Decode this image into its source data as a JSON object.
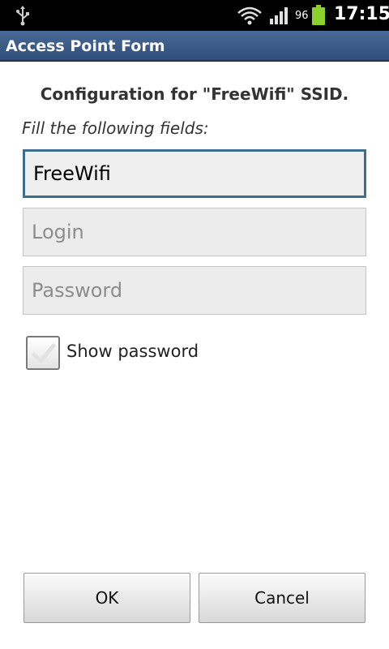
{
  "status_bar": {
    "battery_percent": "96",
    "time": "17:15",
    "icons": [
      "usb-icon",
      "wifi-icon",
      "signal-icon",
      "battery-icon"
    ]
  },
  "title_bar": {
    "title": "Access Point Form"
  },
  "form": {
    "heading": "Configuration for \"FreeWifi\" SSID.",
    "instruction": "Fill the following fields:",
    "ssid_value": "FreeWifi",
    "login_placeholder": "Login",
    "password_placeholder": "Password",
    "show_password_label": "Show password",
    "show_password_checked": false
  },
  "buttons": {
    "ok_label": "OK",
    "cancel_label": "Cancel"
  },
  "colors": {
    "title_bar": "#3a5a86",
    "focus_border": "#3d6f8c",
    "status_bar": "#000000"
  }
}
